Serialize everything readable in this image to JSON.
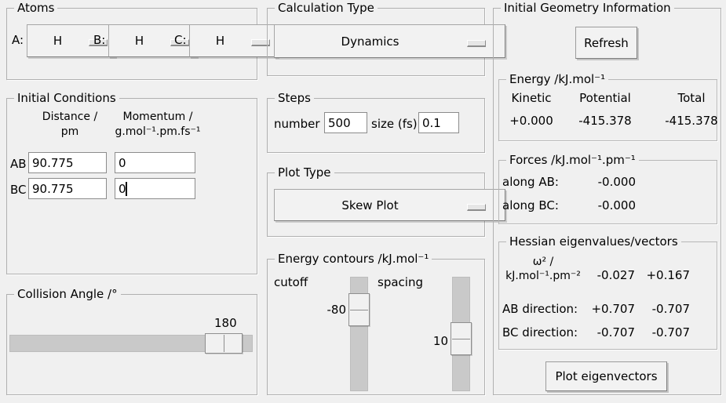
{
  "colors": {
    "window_background": "#f0f0f0",
    "slider_track": "#c9c9c9",
    "field_background": "#ffffff"
  },
  "atoms": {
    "title": "Atoms",
    "items": [
      {
        "label": "A:",
        "value": "H"
      },
      {
        "label": "B:",
        "value": "H"
      },
      {
        "label": "C:",
        "value": "H"
      }
    ]
  },
  "initial_conditions": {
    "title": "Initial Conditions",
    "distance_header_line1": "Distance /",
    "distance_header_line2": "pm",
    "momentum_header_line1": "Momentum /",
    "momentum_header_line2": "g.mol⁻¹.pm.fs⁻¹",
    "rows": [
      {
        "label": "AB",
        "distance": "90.775",
        "momentum": "0"
      },
      {
        "label": "BC",
        "distance": "90.775",
        "momentum": "0"
      }
    ]
  },
  "collision_angle": {
    "title": "Collision Angle /°",
    "value": "180"
  },
  "calculation_type": {
    "title": "Calculation Type",
    "value": "Dynamics"
  },
  "steps": {
    "title": "Steps",
    "number_label": "number",
    "number_value": "500",
    "size_label": "size (fs)",
    "size_value": "0.1"
  },
  "plot_type": {
    "title": "Plot Type",
    "value": "Skew Plot"
  },
  "energy_contours": {
    "title": "Energy contours /kJ.mol⁻¹",
    "cutoff_label": "cutoff",
    "cutoff_value": "-80",
    "spacing_label": "spacing",
    "spacing_value": "10"
  },
  "geometry": {
    "title": "Initial Geometry Information",
    "refresh_label": "Refresh",
    "energy": {
      "title": "Energy /kJ.mol⁻¹",
      "headers": [
        "Kinetic",
        "Potential",
        "Total"
      ],
      "values": [
        "+0.000",
        "-415.378",
        "-415.378"
      ]
    },
    "forces": {
      "title": "Forces /kJ.mol⁻¹.pm⁻¹",
      "rows": [
        {
          "label": "along AB:",
          "value": "-0.000"
        },
        {
          "label": "along BC:",
          "value": "-0.000"
        }
      ]
    },
    "hessian": {
      "title": "Hessian eigenvalues/vectors",
      "omega_label_line1": "ω² /",
      "omega_label_line2": "kJ.mol⁻¹.pm⁻²",
      "omega_values": [
        "-0.027",
        "+0.167"
      ],
      "ab_label": "AB direction:",
      "ab_values": [
        "+0.707",
        "-0.707"
      ],
      "bc_label": "BC direction:",
      "bc_values": [
        "-0.707",
        "-0.707"
      ]
    },
    "plot_button_label": "Plot eigenvectors"
  }
}
